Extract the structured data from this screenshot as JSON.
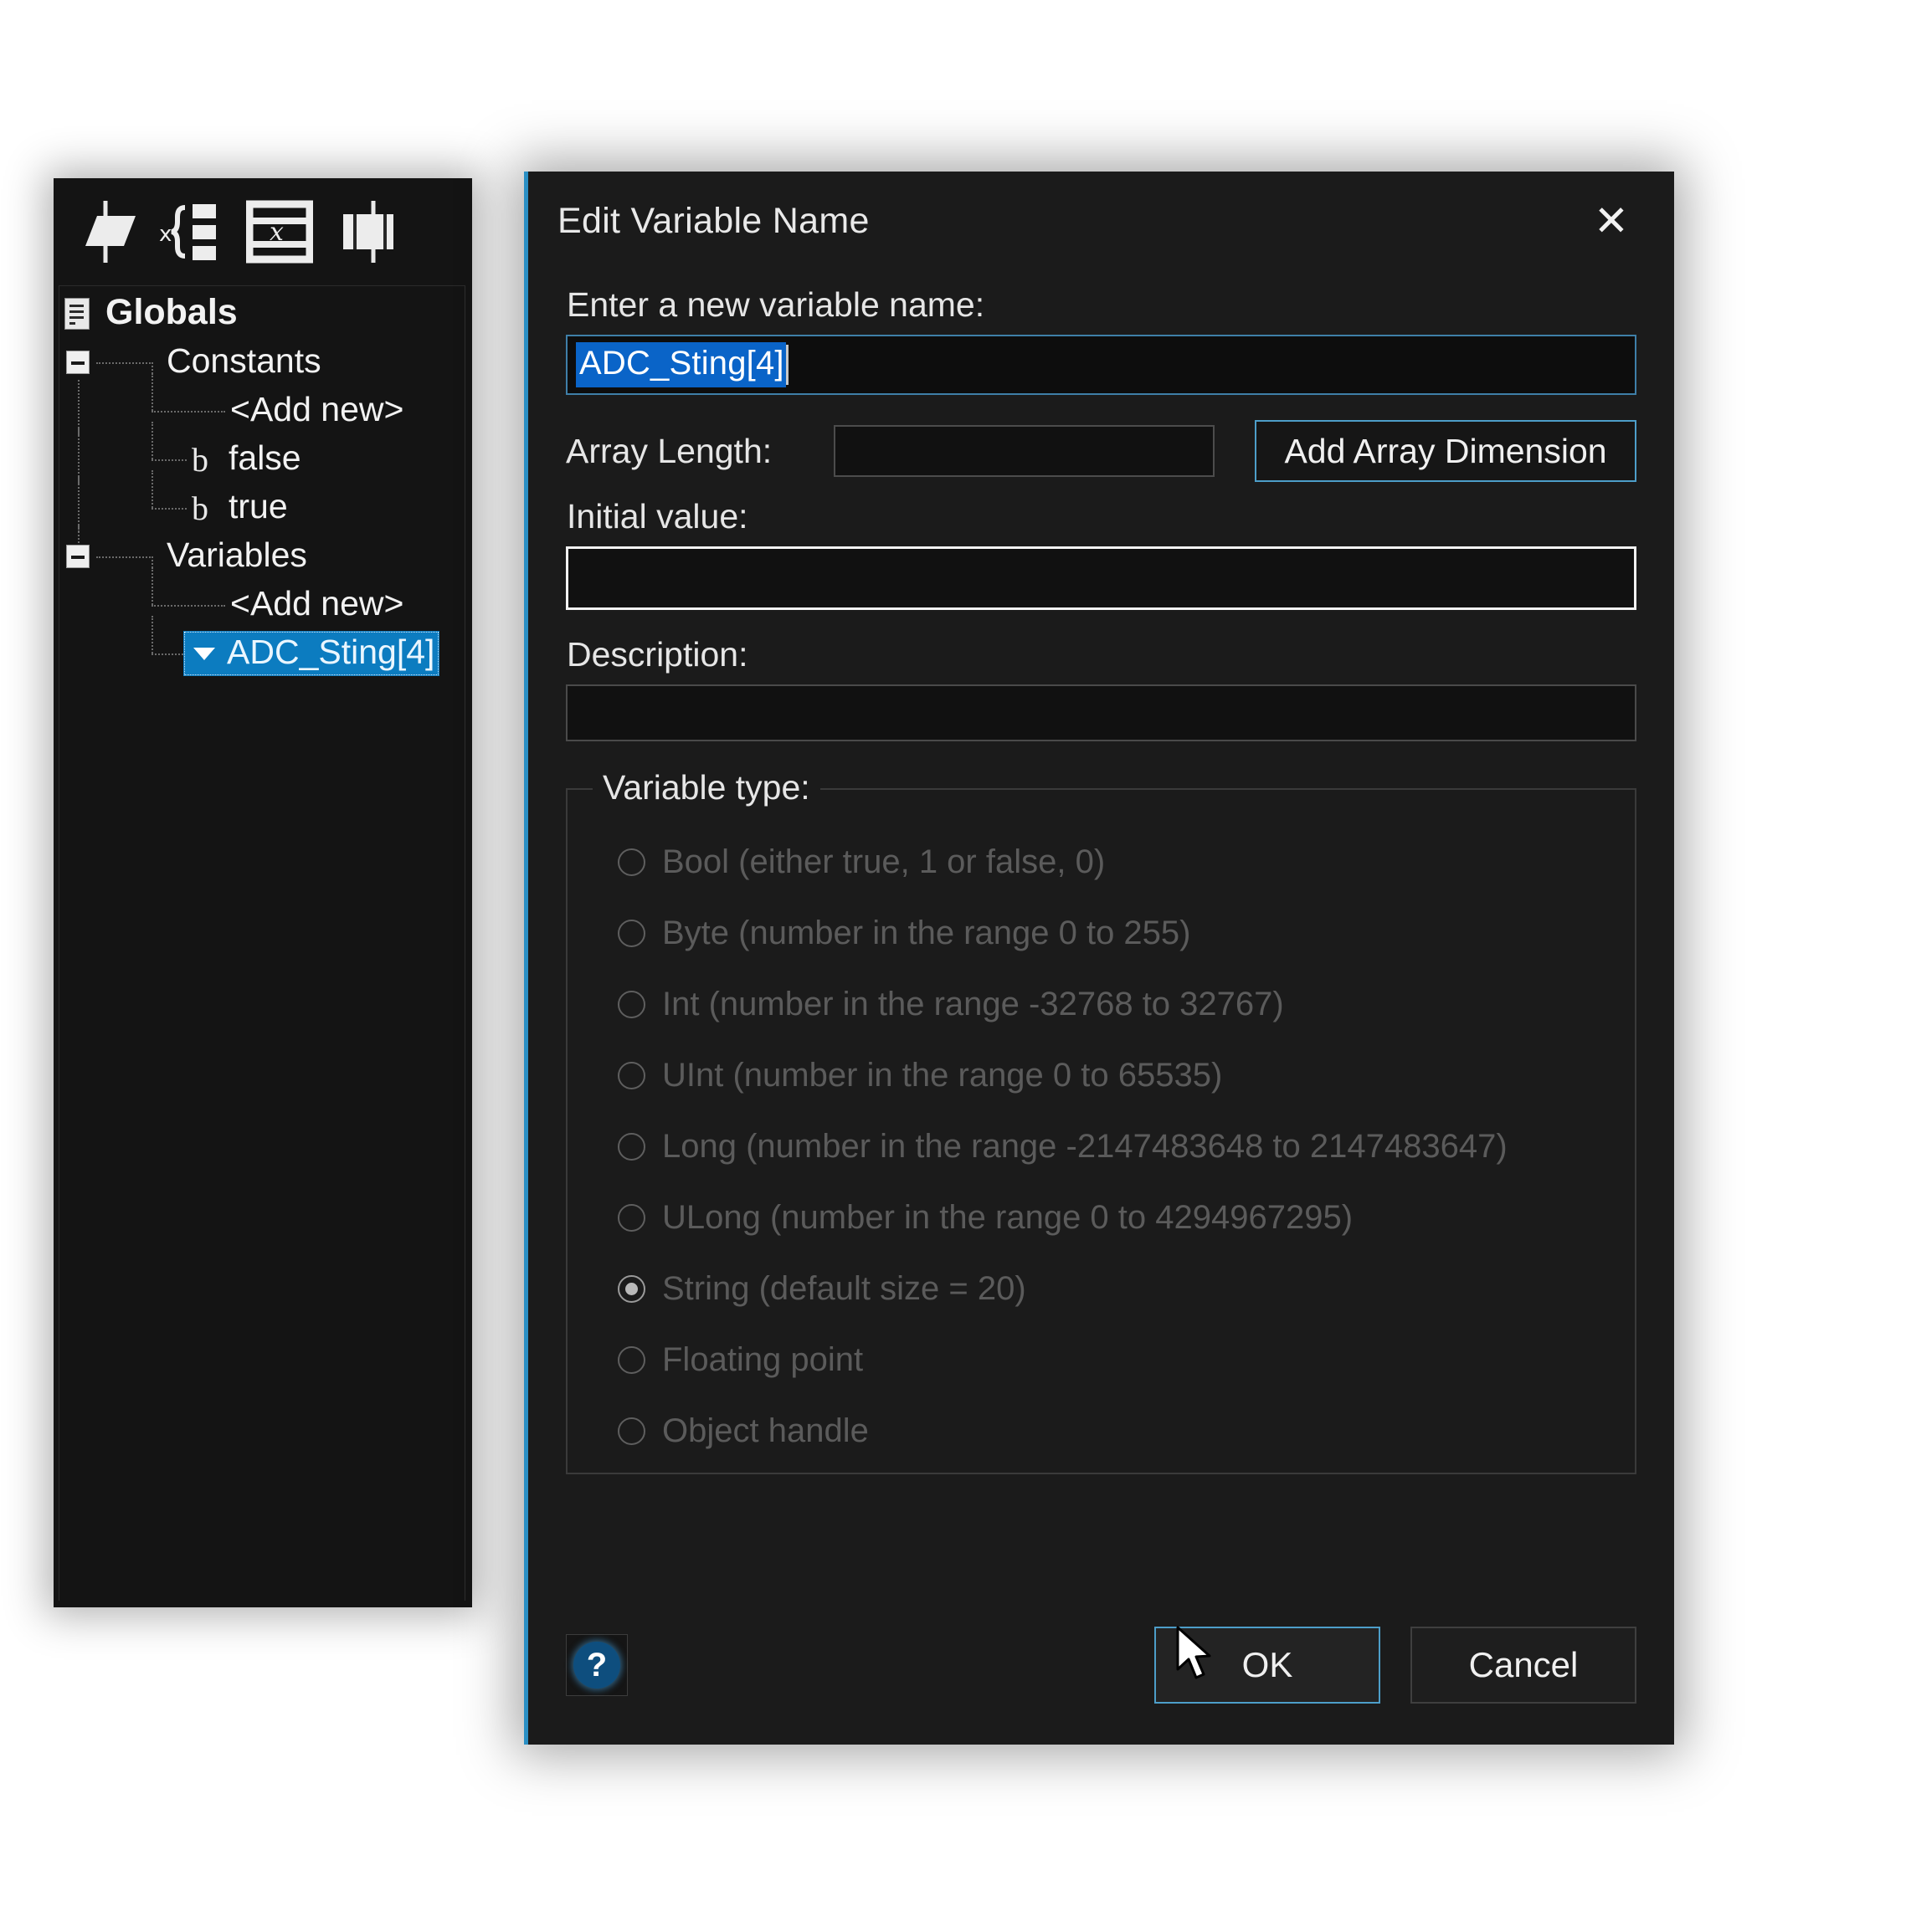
{
  "tree_panel": {
    "toolbar_icons": [
      {
        "name": "new-flowchart-icon"
      },
      {
        "name": "variables-braces-icon"
      },
      {
        "name": "expression-table-icon"
      },
      {
        "name": "component-panel-icon"
      }
    ],
    "items": [
      {
        "label": "Globals",
        "icon": "document-icon",
        "depth": 0,
        "expander": "none",
        "bold": true
      },
      {
        "label": "Constants",
        "icon": "none",
        "depth": 1,
        "expander": "minus"
      },
      {
        "label": "<Add new>",
        "icon": "none",
        "depth": 2,
        "expander": "none"
      },
      {
        "label": "false",
        "icon": "bool-b-glyph",
        "depth": 2,
        "expander": "none"
      },
      {
        "label": "true",
        "icon": "bool-b-glyph",
        "depth": 2,
        "expander": "none"
      },
      {
        "label": "Variables",
        "icon": "none",
        "depth": 1,
        "expander": "minus"
      },
      {
        "label": "<Add new>",
        "icon": "none",
        "depth": 2,
        "expander": "none"
      },
      {
        "label": "ADC_Sting[4]",
        "icon": "array-dropdown-icon",
        "depth": 2,
        "expander": "none",
        "selected": true
      }
    ]
  },
  "dialog": {
    "title": "Edit Variable Name",
    "close_label": "✕",
    "name_label": "Enter a new variable name:",
    "name_value": "ADC_Sting[4]",
    "name_value_selected": true,
    "array_length_label": "Array Length:",
    "array_length_value": "",
    "add_array_dimension_label": "Add Array Dimension",
    "initial_value_label": "Initial value:",
    "initial_value": "",
    "description_label": "Description:",
    "description_value": "",
    "variable_type_legend": "Variable type:",
    "variable_types": [
      {
        "label": "Bool (either true, 1 or false, 0)",
        "checked": false
      },
      {
        "label": "Byte (number in the range 0 to 255)",
        "checked": false
      },
      {
        "label": "Int (number in the range -32768 to 32767)",
        "checked": false
      },
      {
        "label": "UInt (number in the range 0 to 65535)",
        "checked": false
      },
      {
        "label": "Long (number in the range -2147483648 to 2147483647)",
        "checked": false
      },
      {
        "label": "ULong (number in the range 0 to 4294967295)",
        "checked": false
      },
      {
        "label": "String (default size = 20)",
        "checked": true
      },
      {
        "label": "Floating point",
        "checked": false
      },
      {
        "label": "Object handle",
        "checked": false
      }
    ],
    "help_label": "?",
    "ok_label": "OK",
    "cancel_label": "Cancel"
  },
  "colors": {
    "accent_blue": "#2a8fc4",
    "selection_blue": "#0a64c8",
    "tree_selection_blue": "#0c7cc0",
    "panel_bg": "#141414",
    "dialog_bg": "#1b1b1b",
    "disabled_text": "#5b5b5b"
  }
}
